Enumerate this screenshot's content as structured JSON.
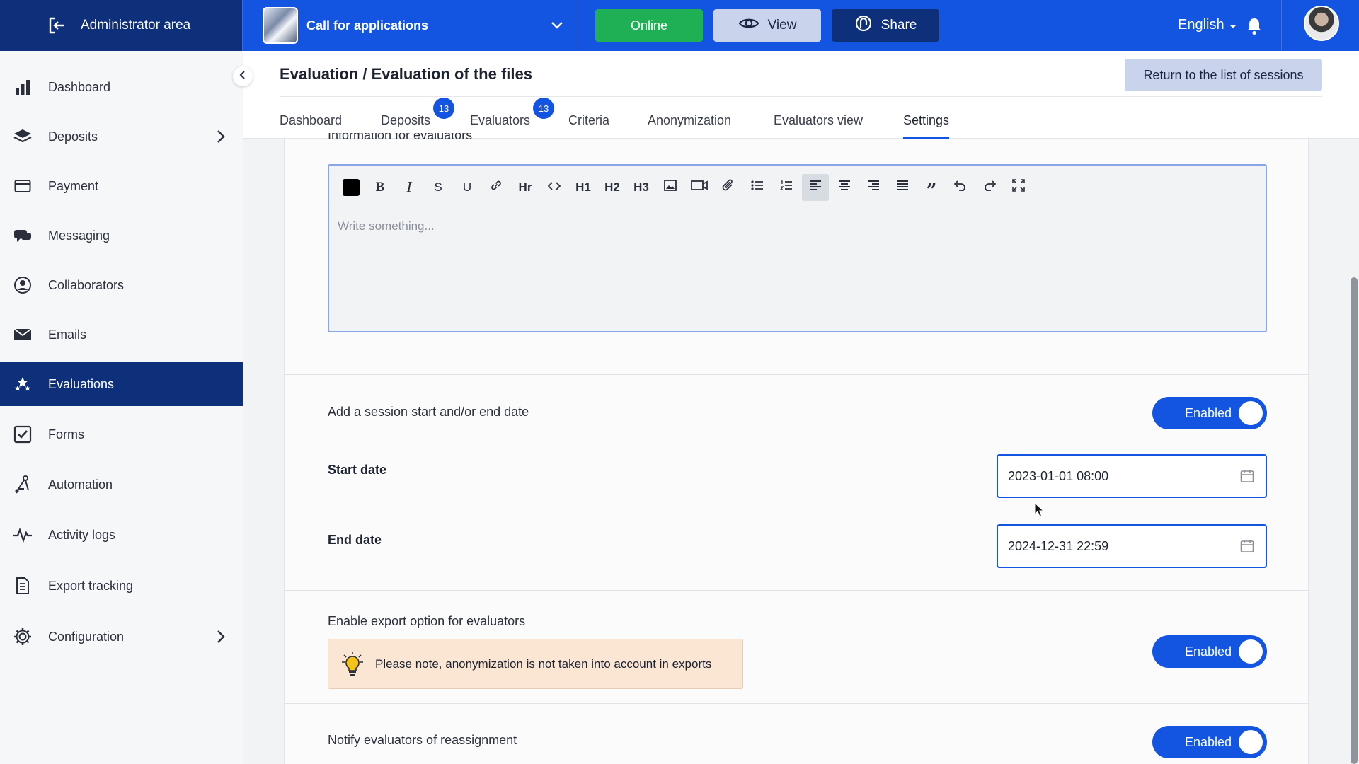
{
  "topbar": {
    "admin_label": "Administrator area",
    "project_name": "Call for applications",
    "online_label": "Online",
    "view_label": "View",
    "share_label": "Share",
    "language": "English",
    "colors": {
      "bar": "#1355e0",
      "admin": "#0e2f7a",
      "online": "#1fb055"
    }
  },
  "sidebar": {
    "items": [
      {
        "label": "Dashboard",
        "icon": "bar-chart-icon"
      },
      {
        "label": "Deposits",
        "icon": "layers-icon",
        "has_submenu": true
      },
      {
        "label": "Payment",
        "icon": "credit-card-icon"
      },
      {
        "label": "Messaging",
        "icon": "chat-icon"
      },
      {
        "label": "Collaborators",
        "icon": "user-circle-icon"
      },
      {
        "label": "Emails",
        "icon": "envelope-icon"
      },
      {
        "label": "Evaluations",
        "icon": "stars-icon",
        "active": true
      },
      {
        "label": "Forms",
        "icon": "checkbox-icon"
      },
      {
        "label": "Automation",
        "icon": "automation-icon"
      },
      {
        "label": "Activity logs",
        "icon": "pulse-icon"
      },
      {
        "label": "Export tracking",
        "icon": "document-icon"
      },
      {
        "label": "Configuration",
        "icon": "gear-icon",
        "has_submenu": true
      }
    ]
  },
  "header": {
    "breadcrumb": "Evaluation / Evaluation of the files",
    "return_label": "Return to the list of sessions",
    "tabs": [
      {
        "label": "Dashboard"
      },
      {
        "label": "Deposits",
        "badge": "13"
      },
      {
        "label": "Evaluators",
        "badge": "13"
      },
      {
        "label": "Criteria"
      },
      {
        "label": "Anonymization"
      },
      {
        "label": "Evaluators view"
      },
      {
        "label": "Settings",
        "active": true
      }
    ]
  },
  "editor": {
    "label": "Information for evaluators",
    "placeholder": "Write something...",
    "toolbar_text": {
      "hr": "Hr",
      "h1": "H1",
      "h2": "H2",
      "h3": "H3"
    }
  },
  "settings": {
    "session_dates": {
      "label": "Add a session start and/or end date",
      "toggle": "Enabled"
    },
    "start_date": {
      "label": "Start date",
      "value": "2023-01-01 08:00"
    },
    "end_date": {
      "label": "End date",
      "value": "2024-12-31 22:59"
    },
    "export_option": {
      "label": "Enable export option for evaluators",
      "toggle": "Enabled",
      "notice": "Please note, anonymization is not taken into account in exports"
    },
    "notify": {
      "label": "Notify evaluators of reassignment",
      "toggle": "Enabled"
    }
  }
}
